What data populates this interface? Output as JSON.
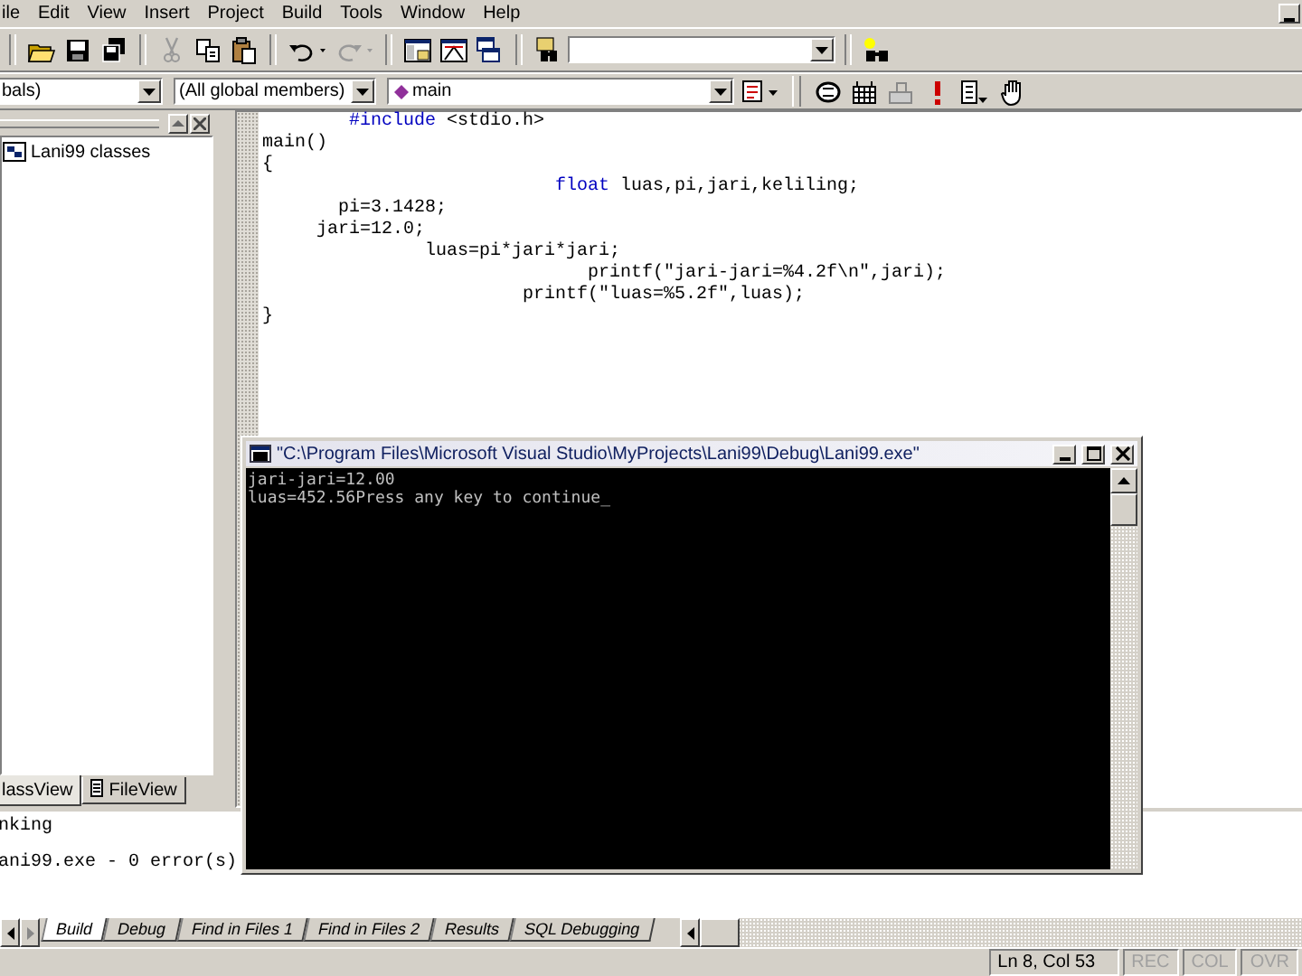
{
  "menu_bar": {
    "items": [
      "ile",
      "Edit",
      "View",
      "Insert",
      "Project",
      "Build",
      "Tools",
      "Window",
      "Help"
    ]
  },
  "wizard_bar": {
    "class_combo": "bals)",
    "members_combo": "(All global members)",
    "function_combo": "main"
  },
  "workspace": {
    "tree": [
      {
        "label": "Lani99 classes"
      }
    ],
    "tabs": [
      {
        "label": "lassView",
        "selected": true
      },
      {
        "label": "FileView",
        "selected": false
      }
    ]
  },
  "editor": {
    "lines": [
      [
        {
          "text": "        #include",
          "kind": "keyword"
        },
        {
          "text": " <stdio.h>",
          "kind": "plain"
        }
      ],
      [
        {
          "text": "main()",
          "kind": "plain"
        }
      ],
      [
        {
          "text": "{",
          "kind": "plain"
        }
      ],
      [
        {
          "text": "                           float",
          "kind": "keyword"
        },
        {
          "text": " luas,pi,jari,keliling;",
          "kind": "plain"
        }
      ],
      [
        {
          "text": "       pi=3.1428;",
          "kind": "plain"
        }
      ],
      [
        {
          "text": "     jari=12.0;",
          "kind": "plain"
        }
      ],
      [
        {
          "text": "               luas=pi*jari*jari;",
          "kind": "plain"
        }
      ],
      [
        {
          "text": "                              printf(\"jari-jari=%4.2f\\n\",jari);",
          "kind": "plain"
        }
      ],
      [
        {
          "text": "                        printf(\"luas=%5.2f\",luas);",
          "kind": "plain"
        }
      ],
      [
        {
          "text": "}",
          "kind": "plain"
        }
      ]
    ]
  },
  "console": {
    "title": "\"C:\\Program Files\\Microsoft Visual Studio\\MyProjects\\Lani99\\Debug\\Lani99.exe\"",
    "lines": [
      "jari-jari=12.00",
      "luas=452.56Press any key to continue_"
    ]
  },
  "output": {
    "lines": [
      "nking",
      "ani99.exe - 0 error(s)"
    ],
    "tabs": [
      {
        "label": "Build",
        "selected": true
      },
      {
        "label": "Debug",
        "selected": false
      },
      {
        "label": "Find in Files 1",
        "selected": false
      },
      {
        "label": "Find in Files 2",
        "selected": false
      },
      {
        "label": "Results",
        "selected": false
      },
      {
        "label": "SQL Debugging",
        "selected": false
      }
    ]
  },
  "status_bar": {
    "position": "Ln 8, Col 53",
    "indicators": [
      {
        "label": "REC",
        "disabled": true
      },
      {
        "label": "COL",
        "disabled": true
      },
      {
        "label": "OVR",
        "disabled": true
      }
    ]
  }
}
